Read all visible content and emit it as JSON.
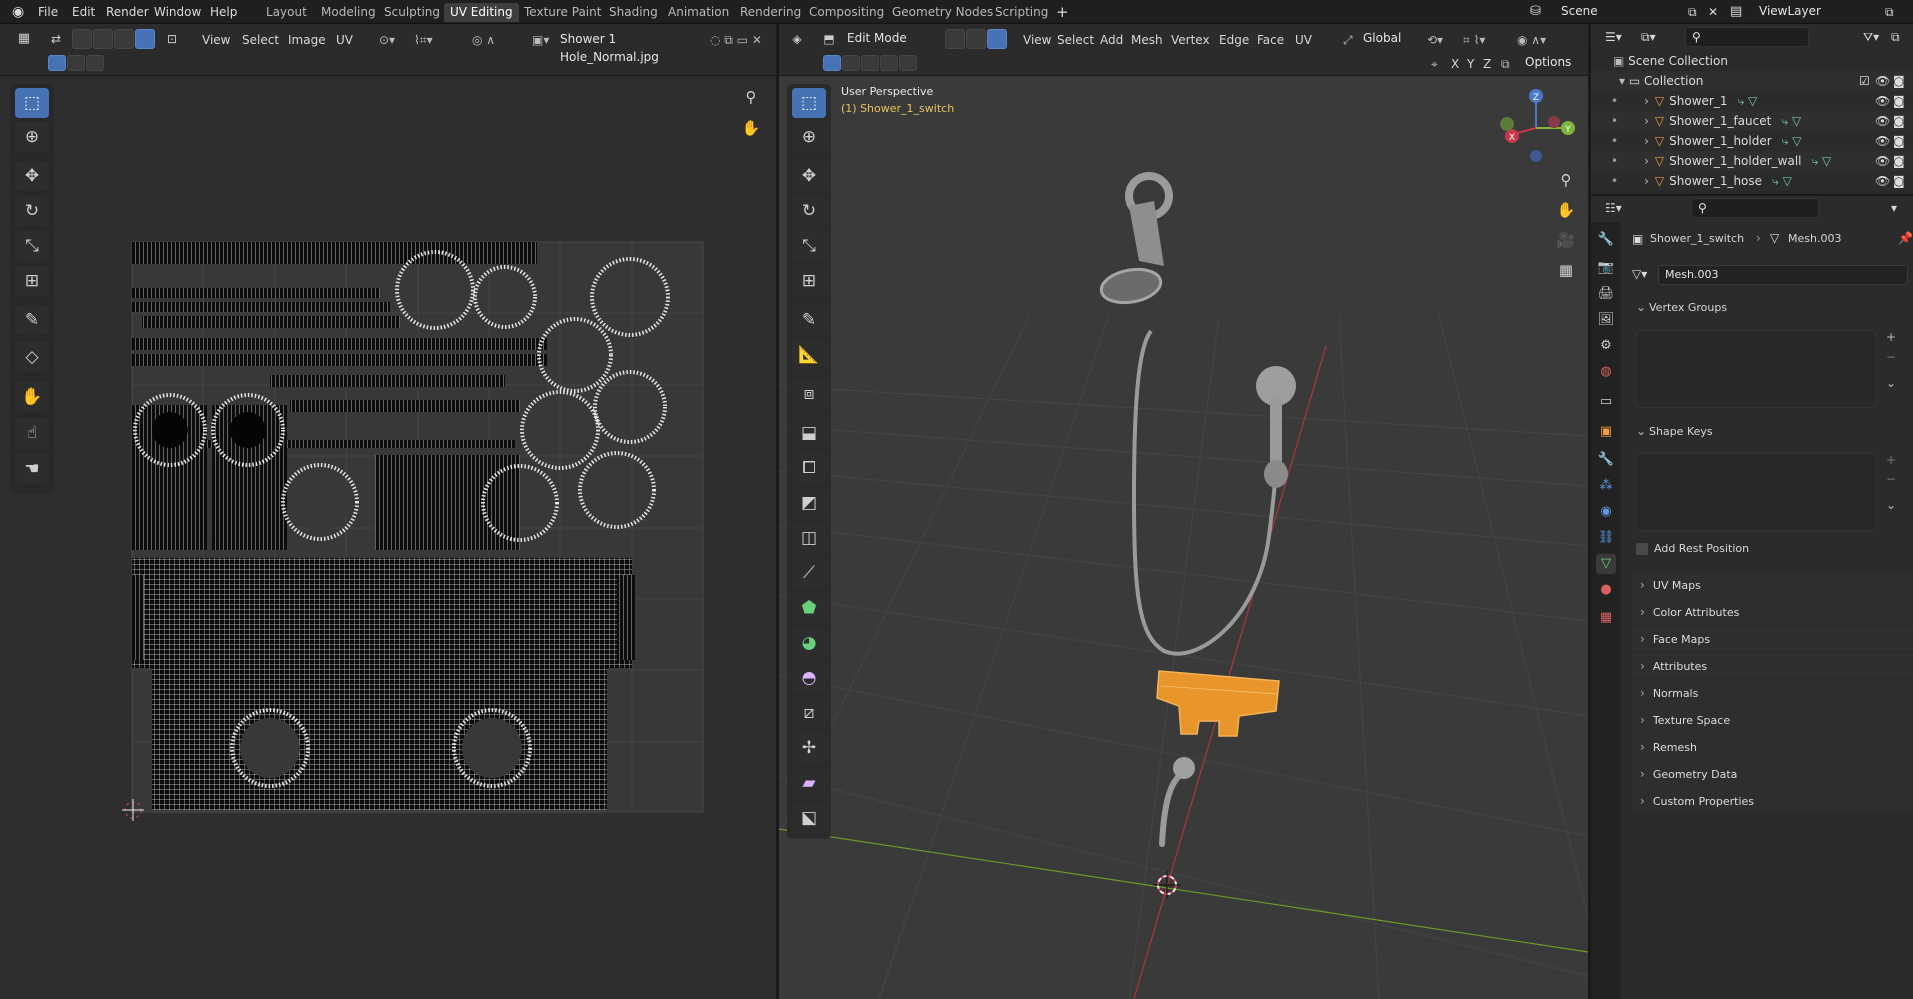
{
  "menu": {
    "file": "File",
    "edit": "Edit",
    "render": "Render",
    "window": "Window",
    "help": "Help"
  },
  "workspaces": [
    "Layout",
    "Modeling",
    "Sculpting",
    "UV Editing",
    "Texture Paint",
    "Shading",
    "Animation",
    "Rendering",
    "Compositing",
    "Geometry Nodes",
    "Scripting"
  ],
  "active_workspace": "UV Editing",
  "scene": {
    "name": "Scene",
    "view_layer": "ViewLayer"
  },
  "uv_editor": {
    "menus": {
      "view": "View",
      "select": "Select",
      "image": "Image",
      "uv": "UV"
    },
    "image_name": "Shower 1 Hole_Normal.jpg"
  },
  "viewport": {
    "mode": "Edit Mode",
    "menus": {
      "view": "View",
      "select": "Select",
      "add": "Add",
      "mesh": "Mesh",
      "vertex": "Vertex",
      "edge": "Edge",
      "face": "Face",
      "uv": "UV"
    },
    "orientation": "Global",
    "axes": {
      "x": "X",
      "y": "Y",
      "z": "Z"
    },
    "options": "Options",
    "perspective": "User Perspective",
    "object_info": "(1) Shower_1_switch",
    "gizmo": {
      "x": "X",
      "y": "Y",
      "z": "Z"
    }
  },
  "outliner": {
    "scene_collection": "Scene Collection",
    "collection": "Collection",
    "objects": [
      "Shower_1",
      "Shower_1_faucet",
      "Shower_1_holder",
      "Shower_1_holder_wall",
      "Shower_1_hose"
    ]
  },
  "properties": {
    "object": "Shower_1_switch",
    "mesh": "Mesh.003",
    "mesh_field": "Mesh.003",
    "vertex_groups": "Vertex Groups",
    "shape_keys": "Shape Keys",
    "add_rest_position": "Add Rest Position",
    "sections": [
      "UV Maps",
      "Color Attributes",
      "Face Maps",
      "Attributes",
      "Normals",
      "Texture Space",
      "Remesh",
      "Geometry Data",
      "Custom Properties"
    ]
  },
  "colors": {
    "accent": "#4772b3",
    "selected": "#e8952b",
    "x_axis": "#c8384a",
    "y_axis": "#7db43b",
    "z_axis": "#4a78cc"
  }
}
